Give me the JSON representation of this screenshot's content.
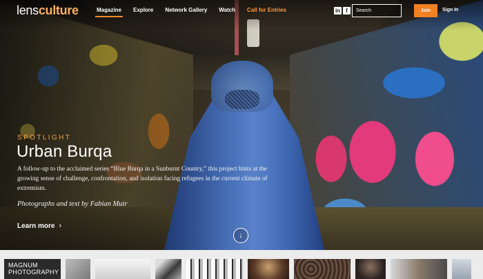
{
  "brand": {
    "logo_light": "lens",
    "logo_bold": "culture"
  },
  "nav": {
    "links": [
      {
        "label": "Magazine",
        "active": true
      },
      {
        "label": "Explore"
      },
      {
        "label": "Network Gallery"
      },
      {
        "label": "Watch"
      },
      {
        "label": "Call for Entries",
        "highlight": true
      }
    ],
    "social": [
      {
        "name": "linkedin-icon",
        "glyph": "in"
      },
      {
        "name": "facebook-icon",
        "glyph": "f"
      }
    ],
    "search_placeholder": "Search",
    "join_label": "Join",
    "signin_label": "Sign In"
  },
  "hero": {
    "kicker": "SPOTLIGHT",
    "title": "Urban Burqa",
    "description": "A follow-up to the acclaimed series “Blue Burqa in a Sunburnt Country,” this project hints at the growing sense of challenge, confrontation, and isolation facing refugees in the current climate of extremism.",
    "credit": "Photographs and text by Fabian Muir",
    "learn_more": "Learn more",
    "learn_more_chevron": "›",
    "scroll_icon": "↓"
  },
  "strip": {
    "label_line1": "MAGNUM",
    "label_line2": "PHOTOGRAPHY"
  },
  "colors": {
    "accent": "#f28122",
    "kicker": "#f6a24a",
    "cta": "#ff9a3a"
  }
}
